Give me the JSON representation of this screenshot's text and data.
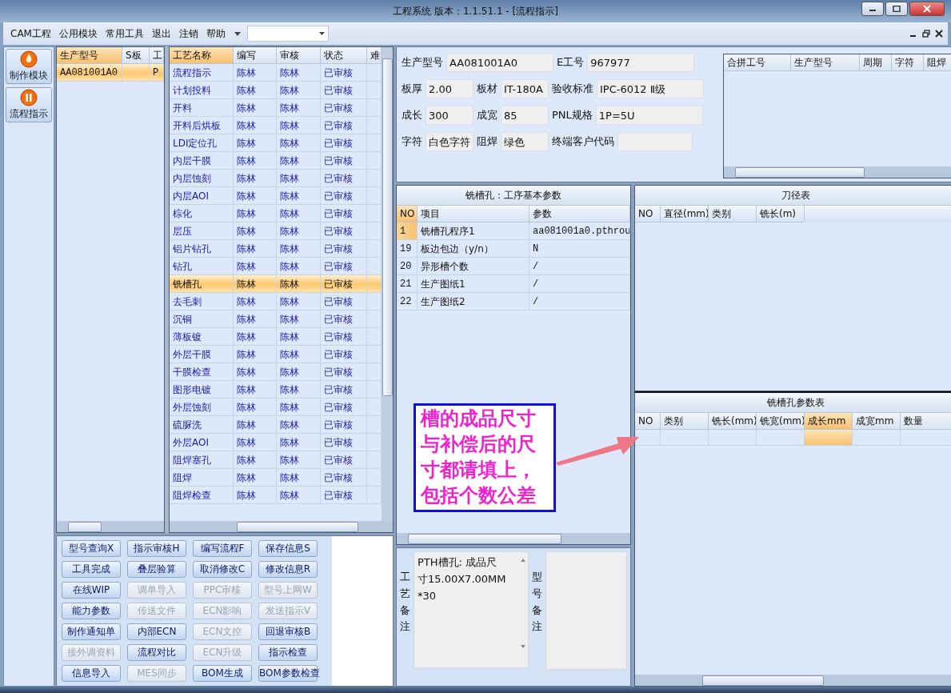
{
  "window": {
    "title": "工程系统  版本：1.1.51.1 - [流程指示]"
  },
  "menu": [
    {
      "label": "CAM工程"
    },
    {
      "label": "公用模块"
    },
    {
      "label": "常用工具"
    },
    {
      "label": "退出"
    },
    {
      "label": "注销"
    },
    {
      "label": "帮助"
    }
  ],
  "nav": [
    {
      "label": "制作模块",
      "kind": "flame"
    },
    {
      "label": "流程指示",
      "kind": "pause"
    }
  ],
  "models": {
    "columns": [
      "生产型号",
      "S板",
      "工"
    ],
    "rows": [
      {
        "model": "AA081001A0",
        "column_3": "P",
        "selected": true
      }
    ]
  },
  "process": {
    "columns": [
      "工艺名称",
      "编写",
      "审核",
      "状态",
      "难"
    ],
    "rows": [
      {
        "name": "流程指示",
        "writer": "陈林",
        "reviewer": "陈林",
        "status": "已审核",
        "selected": false
      },
      {
        "name": "计划投料",
        "writer": "陈林",
        "reviewer": "陈林",
        "status": "已审核",
        "selected": false
      },
      {
        "name": "开料",
        "writer": "陈林",
        "reviewer": "陈林",
        "status": "已审核",
        "selected": false
      },
      {
        "name": "开料后烘板",
        "writer": "陈林",
        "reviewer": "陈林",
        "status": "已审核",
        "selected": false
      },
      {
        "name": "LDI定位孔",
        "writer": "陈林",
        "reviewer": "陈林",
        "status": "已审核",
        "selected": false
      },
      {
        "name": "内层干膜",
        "writer": "陈林",
        "reviewer": "陈林",
        "status": "已审核",
        "selected": false
      },
      {
        "name": "内层蚀刻",
        "writer": "陈林",
        "reviewer": "陈林",
        "status": "已审核",
        "selected": false
      },
      {
        "name": "内层AOI",
        "writer": "陈林",
        "reviewer": "陈林",
        "status": "已审核",
        "selected": false
      },
      {
        "name": "棕化",
        "writer": "陈林",
        "reviewer": "陈林",
        "status": "已审核",
        "selected": false
      },
      {
        "name": "层压",
        "writer": "陈林",
        "reviewer": "陈林",
        "status": "已审核",
        "selected": false
      },
      {
        "name": "铝片钻孔",
        "writer": "陈林",
        "reviewer": "陈林",
        "status": "已审核",
        "selected": false
      },
      {
        "name": "钻孔",
        "writer": "陈林",
        "reviewer": "陈林",
        "status": "已审核",
        "selected": false
      },
      {
        "name": "铣槽孔",
        "writer": "陈林",
        "reviewer": "陈林",
        "status": "已审核",
        "selected": true
      },
      {
        "name": "去毛刺",
        "writer": "陈林",
        "reviewer": "陈林",
        "status": "已审核",
        "selected": false
      },
      {
        "name": "沉铜",
        "writer": "陈林",
        "reviewer": "陈林",
        "status": "已审核",
        "selected": false
      },
      {
        "name": "薄板镀",
        "writer": "陈林",
        "reviewer": "陈林",
        "status": "已审核",
        "selected": false
      },
      {
        "name": "外层干膜",
        "writer": "陈林",
        "reviewer": "陈林",
        "status": "已审核",
        "selected": false
      },
      {
        "name": "干膜检查",
        "writer": "陈林",
        "reviewer": "陈林",
        "status": "已审核",
        "selected": false
      },
      {
        "name": "图形电镀",
        "writer": "陈林",
        "reviewer": "陈林",
        "status": "已审核",
        "selected": false
      },
      {
        "name": "外层蚀刻",
        "writer": "陈林",
        "reviewer": "陈林",
        "status": "已审核",
        "selected": false
      },
      {
        "name": "硫脲洗",
        "writer": "陈林",
        "reviewer": "陈林",
        "status": "已审核",
        "selected": false
      },
      {
        "name": "外层AOI",
        "writer": "陈林",
        "reviewer": "陈林",
        "status": "已审核",
        "selected": false
      },
      {
        "name": "阻焊塞孔",
        "writer": "陈林",
        "reviewer": "陈林",
        "status": "已审核",
        "selected": false
      },
      {
        "name": "阻焊",
        "writer": "陈林",
        "reviewer": "陈林",
        "status": "已审核",
        "selected": false
      },
      {
        "name": "阻焊检查",
        "writer": "陈林",
        "reviewer": "陈林",
        "status": "已审核",
        "selected": false
      }
    ]
  },
  "buttons": [
    {
      "label": "型号查询X",
      "disabled": false
    },
    {
      "label": "指示审核H",
      "disabled": false
    },
    {
      "label": "编写流程F",
      "disabled": false
    },
    {
      "label": "保存信息S",
      "disabled": false
    },
    {
      "label": "工具完成",
      "disabled": false
    },
    {
      "label": "叠层验算",
      "disabled": false
    },
    {
      "label": "取消修改C",
      "disabled": false
    },
    {
      "label": "修改信息R",
      "disabled": false
    },
    {
      "label": "在线WIP",
      "disabled": false
    },
    {
      "label": "调单导入",
      "disabled": true
    },
    {
      "label": "PPC审核",
      "disabled": true
    },
    {
      "label": "型号上网W",
      "disabled": true
    },
    {
      "label": "能力参数",
      "disabled": false
    },
    {
      "label": "传送文件",
      "disabled": true
    },
    {
      "label": "ECN影响",
      "disabled": true
    },
    {
      "label": "发送指示V",
      "disabled": true
    },
    {
      "label": "制作通知单",
      "disabled": false
    },
    {
      "label": "内部ECN",
      "disabled": false
    },
    {
      "label": "ECN文控",
      "disabled": true
    },
    {
      "label": "回退审核B",
      "disabled": false
    },
    {
      "label": "接外调资料",
      "disabled": true
    },
    {
      "label": "流程对比",
      "disabled": false
    },
    {
      "label": "ECN升级",
      "disabled": true
    },
    {
      "label": "指示检查",
      "disabled": false
    },
    {
      "label": "信息导入",
      "disabled": false
    },
    {
      "label": "MES同步",
      "disabled": true
    },
    {
      "label": "BOM生成",
      "disabled": false
    },
    {
      "label": "BOM参数检查",
      "disabled": false
    }
  ],
  "form_rows": [
    {
      "fields": [
        {
          "label": "生产型号",
          "value": "AA081001A0",
          "kind": "wide"
        },
        {
          "label": "E工号",
          "value": "967977",
          "kind": "wide"
        }
      ]
    },
    {
      "fields": [
        {
          "label": "板厚",
          "value": "2.00",
          "kind": "short"
        },
        {
          "label": "板材",
          "value": "IT-180A",
          "kind": "short"
        },
        {
          "label": "验收标准",
          "value": "IPC-6012 Ⅱ级",
          "kind": "wide"
        }
      ]
    },
    {
      "fields": [
        {
          "label": "成长",
          "value": "300",
          "kind": "short"
        },
        {
          "label": "成宽",
          "value": "85",
          "kind": "short"
        },
        {
          "label": "PNL规格",
          "value": "1P=5U",
          "kind": "wide"
        }
      ]
    },
    {
      "fields": [
        {
          "label": "字符",
          "value": "白色字符",
          "kind": "short"
        },
        {
          "label": "阻焊",
          "value": "绿色",
          "kind": "short"
        },
        {
          "label": "终端客户代码",
          "kind": "narrow"
        }
      ]
    }
  ],
  "combined_table": {
    "columns": [
      "合拼工号",
      "生产型号",
      "周期",
      "字符",
      "阻焊"
    ]
  },
  "params": {
    "title": "铣槽孔：工序基本参数",
    "columns": [
      "NO",
      "项目",
      "参数"
    ],
    "rows": [
      {
        "no": "1",
        "item": "铣槽孔程序1",
        "value": "aa081001a0.pthrou",
        "selected": true
      },
      {
        "no": "19",
        "item": "板边包边（y/n）",
        "value": "N",
        "selected": false
      },
      {
        "no": "20",
        "item": "异形槽个数",
        "value": "/",
        "selected": false
      },
      {
        "no": "21",
        "item": "生产图纸1",
        "value": "/",
        "selected": false
      },
      {
        "no": "22",
        "item": "生产图纸2",
        "value": "/",
        "selected": false
      }
    ]
  },
  "note": {
    "text": "槽的成品尺寸与补偿后的尺寸都请填上，包括个数公差"
  },
  "cutter_table": {
    "title": "刀径表",
    "columns": [
      "NO",
      "直径(mm)",
      "类别",
      "铣长(m)"
    ]
  },
  "slot_table": {
    "title": "铣槽孔参数表",
    "columns": [
      {
        "label": "NO",
        "selected": false
      },
      {
        "label": "类别",
        "selected": false
      },
      {
        "label": "铣长(mm)",
        "selected": false
      },
      {
        "label": "铣宽(mm)",
        "selected": false
      },
      {
        "label": "成长mm",
        "selected": true
      },
      {
        "label": "成宽mm",
        "selected": false
      },
      {
        "label": "数量",
        "selected": false
      }
    ]
  },
  "remarks": {
    "process_label": "工艺备注",
    "process_text": "PTH槽孔: 成品尺寸15.00X7.00MM*30",
    "model_label": "型号备注"
  }
}
